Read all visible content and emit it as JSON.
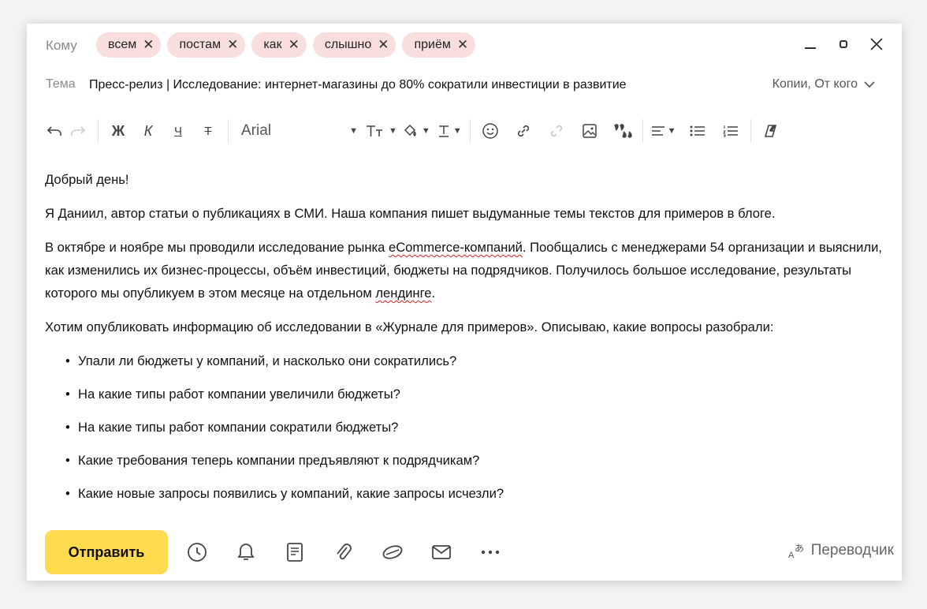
{
  "to": {
    "label": "Кому",
    "recipients": [
      "всем",
      "постам",
      "как",
      "слышно",
      "приём"
    ],
    "remove_glyph": "✕"
  },
  "subject": {
    "label": "Тема",
    "value": "Пресс-релиз | Исследование: интернет-магазины до 80% сократили инвестиции в развитие",
    "cc_label": "Копии, От кого"
  },
  "toolbar": {
    "bold": "Ж",
    "italic": "К",
    "underline": "Ч",
    "strike": "Т",
    "font": "Arial"
  },
  "body": {
    "greeting": "Добрый день!",
    "intro": "Я Даниил, автор статьи о публикациях в СМИ. Наша компания пишет выдуманные темы текстов для примеров в блоге.",
    "p2_a": "В октябре и ноябре мы проводили исследование рынка ",
    "p2_b": "eCommerce-компаний",
    "p2_c": ". Пообщались с менеджерами 54 организации и выяснили, как изменились их бизнес-процессы, объём инвестиций, бюджеты на подрядчиков. Получилось большое исследование, результаты которого мы опубликуем в этом месяце на отдельном ",
    "p2_d": "лендинге",
    "p2_e": ".",
    "p3": "Хотим опубликовать информацию об исследовании в «Журнале для примеров». Описываю, какие вопросы разобрали:",
    "bullets": [
      "Упали ли бюджеты у компаний, и насколько они сократились?",
      "На какие типы работ компании увеличили бюджеты?",
      "На какие типы работ компании сократили бюджеты?",
      "Какие требования теперь компании предъявляют к подрядчикам?",
      "Какие новые запросы появились у компаний, какие запросы исчезли?"
    ]
  },
  "footer": {
    "send_label": "Отправить",
    "translator_label": "Переводчик",
    "icons": [
      "clock-icon",
      "bell-icon",
      "template-icon",
      "attach-icon",
      "disk-icon",
      "envelope-icon",
      "more-icon"
    ]
  },
  "colors": {
    "chip_bg": "#f9dede",
    "send_bg": "#ffdb4d",
    "spell_underline": "#dd2222"
  }
}
